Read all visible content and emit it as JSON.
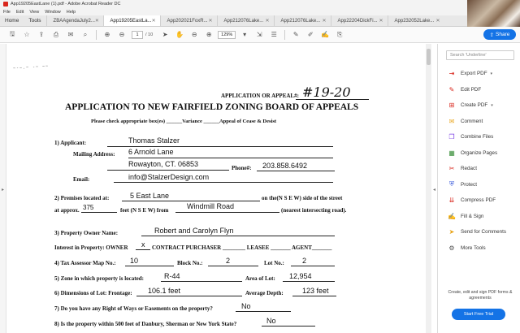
{
  "window": {
    "title": "App19205EastLane (1).pdf - Adobe Acrobat Reader DC",
    "menu": [
      "File",
      "Edit",
      "View",
      "Window",
      "Help"
    ]
  },
  "tabs": {
    "home": "Home",
    "tools": "Tools",
    "docs": [
      "ZBAAgendaJuly2...",
      "App19205EastLa...",
      "App202021FoxR...",
      "App212076Lake...",
      "App212076Lake...",
      "App22204DickFi...",
      "App232052Lake..."
    ],
    "active_index": 1
  },
  "toolbar": {
    "page_current": "1",
    "page_total": "/ 10",
    "zoom": "129%",
    "share_label": "Share"
  },
  "search": {
    "placeholder": "Search 'Underline'"
  },
  "right_tools": [
    {
      "label": "Export PDF",
      "icon": "export-pdf-icon",
      "color": "#d9261c",
      "chevron": true
    },
    {
      "label": "Edit PDF",
      "icon": "edit-pdf-icon",
      "color": "#d9261c",
      "chevron": false
    },
    {
      "label": "Create PDF",
      "icon": "create-pdf-icon",
      "color": "#d9261c",
      "chevron": true
    },
    {
      "label": "Comment",
      "icon": "comment-icon",
      "color": "#e8a317",
      "chevron": false
    },
    {
      "label": "Combine Files",
      "icon": "combine-files-icon",
      "color": "#7b3fe4",
      "chevron": false
    },
    {
      "label": "Organize Pages",
      "icon": "organize-pages-icon",
      "color": "#3a8f3a",
      "chevron": false
    },
    {
      "label": "Redact",
      "icon": "redact-icon",
      "color": "#d9261c",
      "chevron": false
    },
    {
      "label": "Protect",
      "icon": "protect-icon",
      "color": "#3b5bdb",
      "chevron": false
    },
    {
      "label": "Compress PDF",
      "icon": "compress-pdf-icon",
      "color": "#d9261c",
      "chevron": false
    },
    {
      "label": "Fill & Sign",
      "icon": "fill-sign-icon",
      "color": "#9c36b5",
      "chevron": false
    },
    {
      "label": "Send for Comments",
      "icon": "send-comments-icon",
      "color": "#e8a317",
      "chevron": false
    },
    {
      "label": "More Tools",
      "icon": "more-tools-icon",
      "color": "#555555",
      "chevron": false
    }
  ],
  "promo": {
    "text": "Create, edit and sign PDF forms & agreements",
    "button": "Start Free Trial"
  },
  "form": {
    "app_label": "APPLICATION OR APPEAL#:",
    "app_number": "#19-20",
    "heading": "APPLICATION TO NEW FAIRFIELD ZONING BOARD OF APPEALS",
    "check_line": "Please check appropriate box(es) ______Variance ______Appeal of Cease & Desist",
    "applicant_label": "1)  Applicant:",
    "applicant": "Thomas Stalzer",
    "mailing_label": "Mailing Address:",
    "address1": "6 Arnold Lane",
    "address2": "Rowayton, CT. 06853",
    "phone_label": "Phone#:",
    "phone": "203.858.6492",
    "email_label": "Email:",
    "email": "info@StalzerDesign.com",
    "premises_label": "2)  Premises located at:",
    "premises": "5 East Lane",
    "side_text": "on the(N S E W) side of the street",
    "approx_label": "at approx.",
    "approx_feet": "375",
    "feet_text": "feet (N S E W) from",
    "cross_road": "Windmill Road",
    "nearest_text": "(nearest intersecting road).",
    "owner_label": "3)  Property Owner Name:",
    "owner": "Robert and Carolyn Flyn",
    "interest_text": "Interest in Property:  OWNER",
    "interest_mark": "x",
    "interest_rest": "CONTRACT PURCHASER ________ LEASEE _______ AGENT_______",
    "map_label": "4)  Tax Assessor Map No.:",
    "map_no": "10",
    "block_label": "Block No.:",
    "block_no": "2",
    "lot_label": "Lot No.:",
    "lot_no": "2",
    "zone_label": "5)  Zone in which property is located:",
    "zone": "R-44",
    "area_label": "Area of Lot:",
    "area": "12,954",
    "dim_label": "6)  Dimensions of Lot:  Frontage:",
    "frontage": "106.1 feet",
    "depth_label": "Average Depth:",
    "depth": "123 feet",
    "q7": "7)  Do you have any Right of Ways or Easements on the property?",
    "a7": "No",
    "q8": "8)  Is the property within 500 feet of Danbury, Sherman or New York State?",
    "a8": "No",
    "scribble": "~-~.~ -~ ~~"
  }
}
